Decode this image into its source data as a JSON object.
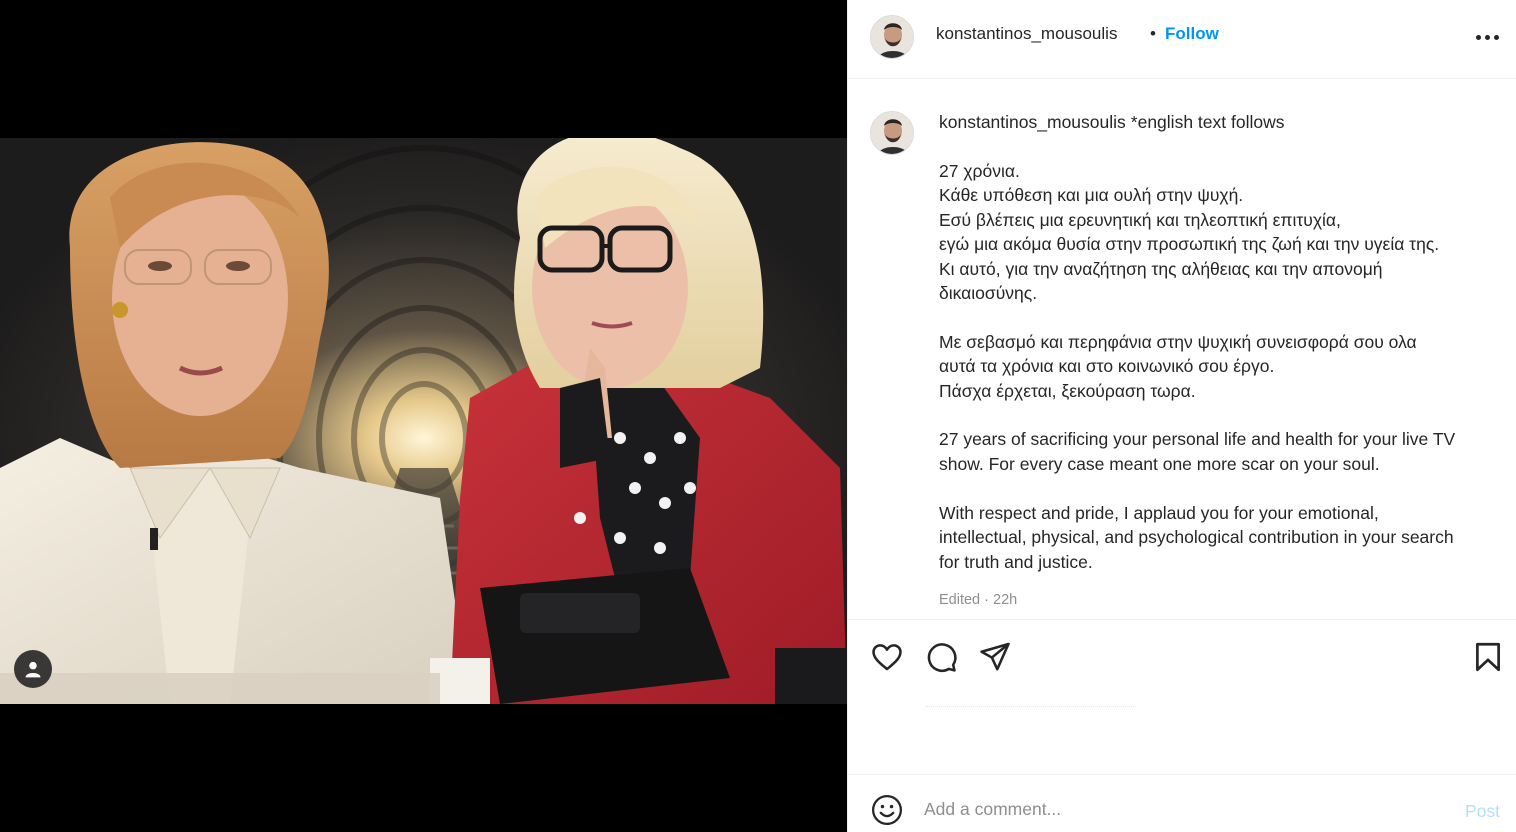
{
  "post": {
    "username": "konstantinos_mousoulis",
    "separator": "•",
    "follow_label": "Follow",
    "more_icon": "more-horizontal-icon"
  },
  "caption": {
    "username": "konstantinos_mousoulis",
    "note": "*english text follows",
    "body": "27 χρόνια.\nΚάθε υπόθεση και μια ουλή στην ψυχή.\nΕσύ βλέπεις μια ερευνητική και τηλεοπτική επιτυχία,\nεγώ μια ακόμα θυσία στην προσωπική της ζωή και την υγεία της.\nΚι αυτό, για την αναζήτηση της αλήθειας και την απονομή\nδικαιοσύνης.\n\nΜε σεβασμό και περηφάνια στην ψυχική συνεισφορά σου ολα\nαυτά τα χρόνια και στο κοινωνικό σου έργο.\nΠάσχα έρχεται, ξεκούραση τωρα.\n\n27 years of sacrificing your personal life and health for your live TV\nshow. For every case meant one more scar on your soul.\n\nWith respect and pride, I applaud you for your emotional,\nintellectual, physical, and psychological contribution in your search\nfor truth and justice.",
    "timestamp": "Edited · 22h"
  },
  "actions": {
    "like_icon": "heart-icon",
    "comment_icon": "comment-bubble-icon",
    "share_icon": "paper-plane-icon",
    "save_icon": "bookmark-icon"
  },
  "comment": {
    "placeholder": "Add a comment...",
    "post_label": "Post",
    "emoji_icon": "emoji-smile-icon"
  },
  "media": {
    "tag_icon": "user-tag-icon"
  },
  "colors": {
    "link": "#0095f6",
    "post_disabled": "#b2dffc",
    "secondary_text": "#8e8e8e",
    "divider": "#efefef"
  }
}
